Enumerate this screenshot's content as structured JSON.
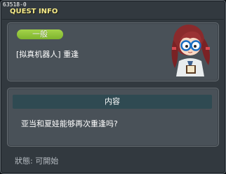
{
  "window": {
    "quest_id": "63518-0",
    "title": "QUEST INFO"
  },
  "quest": {
    "badge": "一般",
    "name": "[拟真机器人] 重逢",
    "avatar_icon": "npc-girl-with-glasses-icon"
  },
  "content": {
    "header": "内容",
    "description": "亚当和夏娃能够再次重逢吗?"
  },
  "footer": {
    "status": "狀態:  可開始"
  },
  "colors": {
    "window_bg": "#32393f",
    "panel_bg": "#495158",
    "title_yellow": "#f6eb89",
    "badge_green": "#8ec33a",
    "header_teal": "#2f4a52"
  }
}
